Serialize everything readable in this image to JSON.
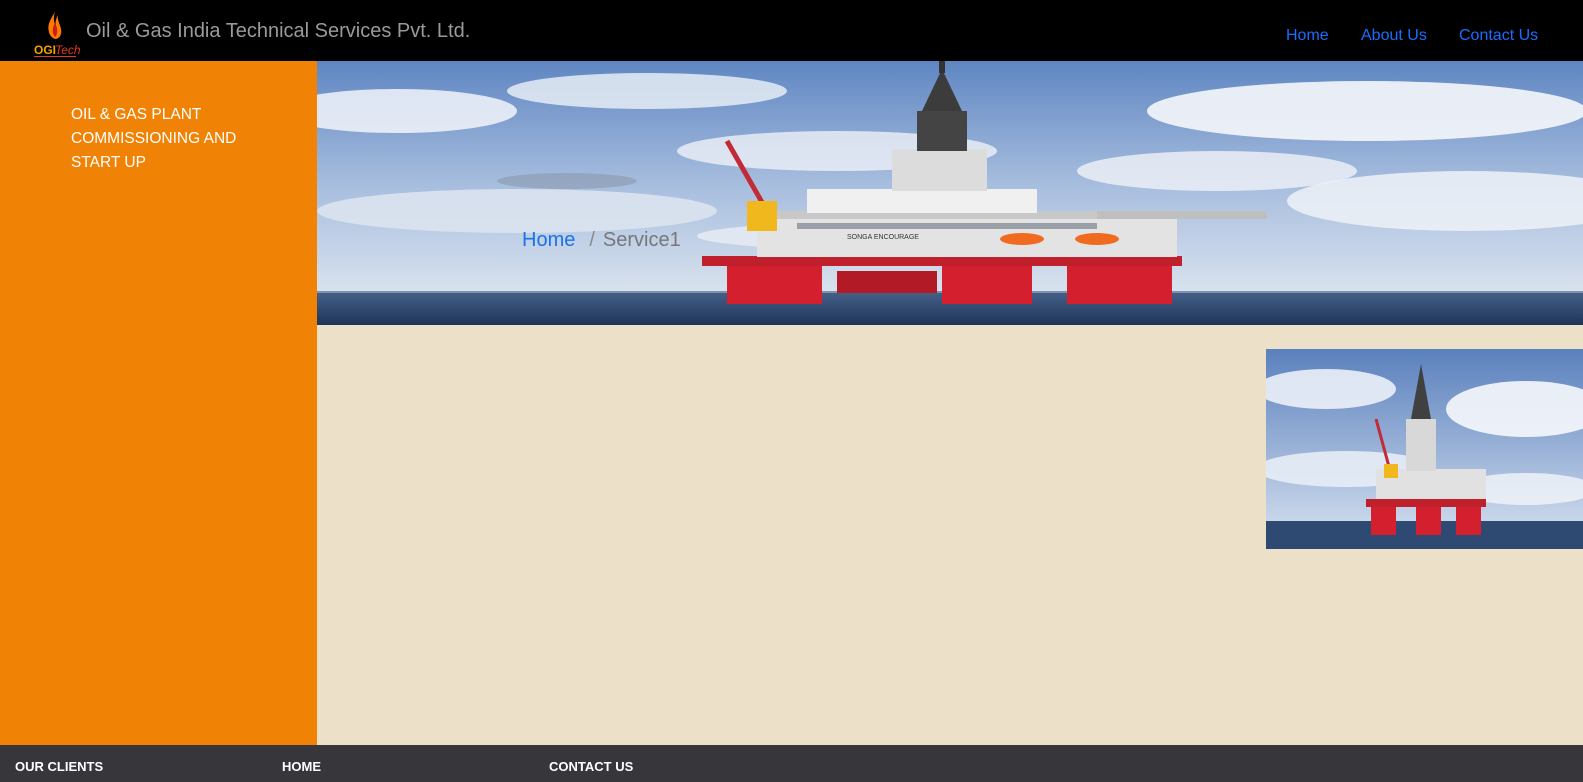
{
  "header": {
    "logo_text": "OGITech",
    "brand": "Oil & Gas India Technical Services Pvt. Ltd.",
    "nav": [
      {
        "label": "Home"
      },
      {
        "label": "About Us"
      },
      {
        "label": "Contact Us"
      }
    ]
  },
  "sidebar": {
    "title": "OIL & GAS PLANT COMMISSIONING AND START UP"
  },
  "hero": {
    "breadcrumb_home": "Home",
    "breadcrumb_sep": "/",
    "breadcrumb_current": "Service1",
    "rig_name": "SONGA ENCOURAGE"
  },
  "footer": {
    "clients": "OUR CLIENTS",
    "home": "HOME",
    "contact": "CONTACT US"
  },
  "colors": {
    "navbar": "#000000",
    "link": "#1a6dff",
    "sidebar": "#f08306",
    "page_bg": "#ede0c8",
    "footer": "#37373b"
  }
}
